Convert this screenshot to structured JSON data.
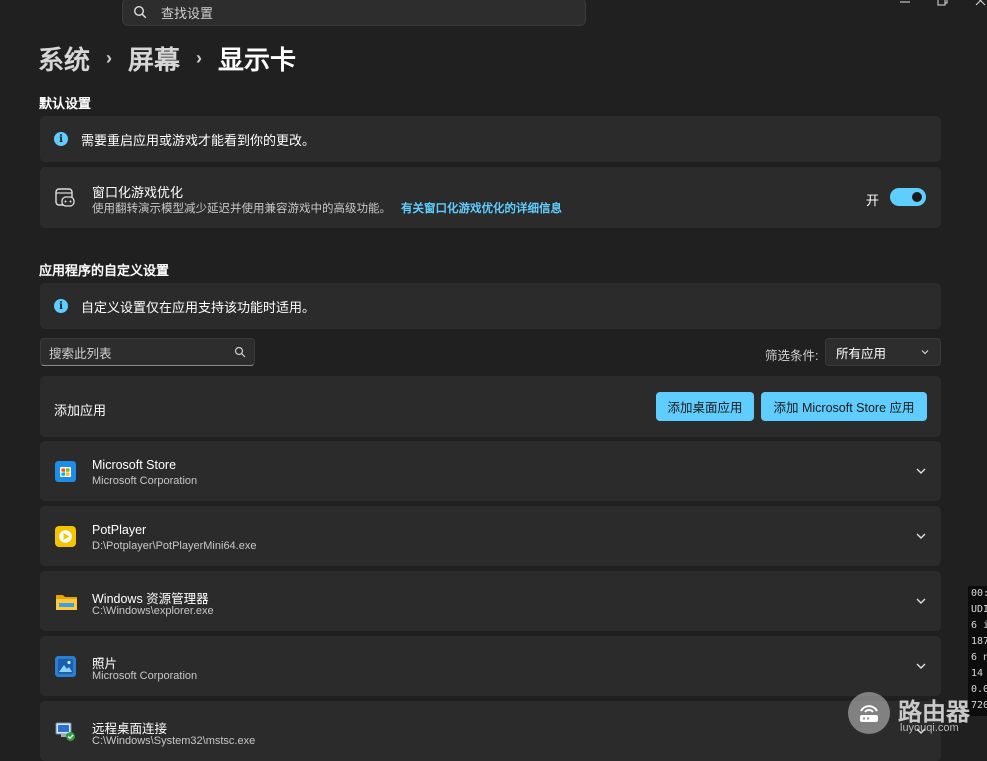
{
  "topbar": {
    "search_placeholder": "查找设置"
  },
  "breadcrumb": [
    "系统",
    "屏幕",
    "显示卡"
  ],
  "default_section": {
    "title": "默认设置",
    "info_text": "需要重启应用或游戏才能看到你的更改。",
    "windowed_opt": {
      "title": "窗口化游戏优化",
      "description": "使用翻转演示模型减少延迟并使用兼容游戏中的高级功能。",
      "link": "有关窗口化游戏优化的详细信息",
      "toggle_label": "开",
      "toggle_on": true
    }
  },
  "custom_section": {
    "title": "应用程序的自定义设置",
    "info_text": "自定义设置仅在应用支持该功能时适用。",
    "list_search_placeholder": "搜索此列表",
    "filter_label": "筛选条件:",
    "filter_value": "所有应用",
    "add_app_label": "添加应用",
    "add_desktop_button": "添加桌面应用",
    "add_store_button": "添加 Microsoft Store 应用"
  },
  "apps": [
    {
      "name": "Microsoft Store",
      "sub": "Microsoft Corporation",
      "icon": "store-icon"
    },
    {
      "name": "PotPlayer",
      "sub": "D:\\Potplayer\\PotPlayerMini64.exe",
      "icon": "potplayer-icon"
    },
    {
      "name": "Windows 资源管理器",
      "sub": "C:\\Windows\\explorer.exe",
      "icon": "folder-icon"
    },
    {
      "name": "照片",
      "sub": "Microsoft Corporation",
      "icon": "photos-icon"
    },
    {
      "name": "远程桌面连接",
      "sub": "C:\\Windows\\System32\\mstsc.exe",
      "icon": "remote-desktop-icon"
    }
  ],
  "console_lines": [
    "00:",
    "UDI",
    "6 i",
    "187",
    "6 n",
    "14",
    "0.0",
    "720"
  ],
  "watermark": {
    "title": "路由器",
    "sub": "luyouqi.com"
  },
  "colors": {
    "background": "#202020",
    "card": "#2b2b2b",
    "accent": "#60cdff"
  }
}
